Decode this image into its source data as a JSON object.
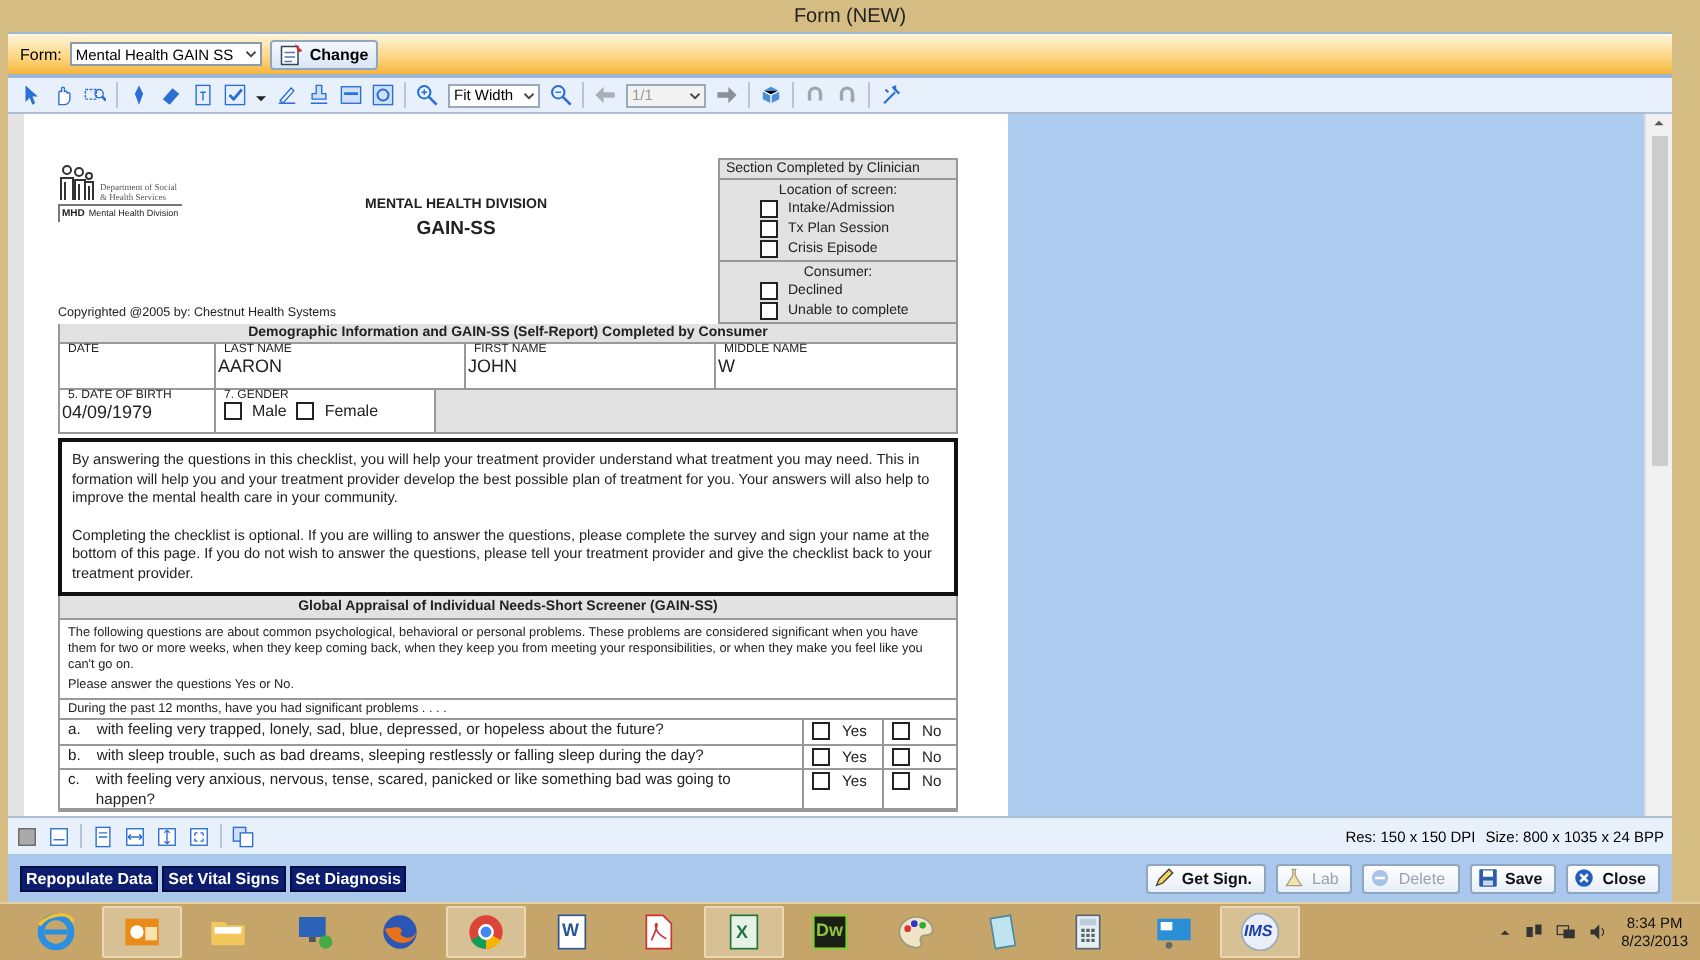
{
  "window": {
    "title": "Form (NEW)"
  },
  "form_selector": {
    "label": "Form:",
    "value": "Mental Health GAIN SS",
    "button": "Change"
  },
  "toolbar": {
    "zoom": "Fit Width",
    "page": "1/1"
  },
  "document": {
    "logo": {
      "agency": "Department of Social & Health Services",
      "unit": "MHD",
      "unit_name": "Mental Health Division"
    },
    "division": "MENTAL HEALTH DIVISION",
    "title": "GAIN-SS",
    "copyright": "Copyrighted @2005 by: Chestnut Health Systems",
    "clinician_box": {
      "title": "Section Completed by Clinician",
      "location_label": "Location of screen:",
      "location_options": [
        {
          "label": "Intake/Admission",
          "checked": false
        },
        {
          "label": "Tx Plan Session",
          "checked": false
        },
        {
          "label": "Crisis Episode",
          "checked": false
        }
      ],
      "consumer_label": "Consumer:",
      "consumer_options": [
        {
          "label": "Declined",
          "checked": false
        },
        {
          "label": "Unable to complete",
          "checked": false
        }
      ]
    },
    "demographics": {
      "title": "Demographic Information and GAIN-SS (Self-Report) Completed by Consumer",
      "name_fields": [
        {
          "label": "DATE"
        },
        {
          "label": "LAST NAME",
          "value": "AARON"
        },
        {
          "label": "FIRST NAME",
          "value": "JOHN"
        },
        {
          "label": "MIDDLE NAME",
          "value": "W"
        }
      ],
      "birth": {
        "label": "5. DATE OF BIRTH",
        "value": "04/09/1979"
      },
      "gender": {
        "label": "7. GENDER",
        "options": [
          {
            "label": "Male",
            "checked": false
          },
          {
            "label": "Female",
            "checked": false
          }
        ]
      }
    },
    "consent_paragraphs": [
      "By answering the questions in this checklist, you will help your treatment provider understand what treatment you may need.  This in formation will help you and your treatment provider develop the best possible plan of treatment for you.  Your answers will also help to improve the mental health care in your community.",
      "Completing the checklist is optional.  If you are willing to answer the questions, please complete the survey and sign your name at the bottom of this page.  If you do not wish to answer the questions, please tell your treatment provider and give the checklist back to your treatment provider."
    ],
    "screener": {
      "title": "Global Appraisal of Individual Needs-Short Screener (GAIN-SS)",
      "intro": "The following questions are about common psychological, behavioral or personal problems.  These problems are considered significant when you have them for two or more weeks, when they keep coming back, when they keep you from meeting your responsibilities, or when they make you feel like you can't go on.",
      "instruction": "Please answer the questions Yes or No.",
      "lead": "During the past 12 months, have you had significant problems . . . .",
      "questions": [
        {
          "letter": "a.",
          "text": "with feeling very trapped, lonely, sad, blue, depressed, or hopeless about the future?",
          "yes_label": "Yes",
          "no_label": "No",
          "yes_checked": false,
          "no_checked": false
        },
        {
          "letter": "b.",
          "text": "with sleep trouble, such as bad dreams, sleeping restlessly or falling sleep during the day?",
          "yes_label": "Yes",
          "no_label": "No",
          "yes_checked": false,
          "no_checked": false
        },
        {
          "letter": "c.",
          "text": "with feeling very anxious, nervous, tense, scared, panicked or like something bad was going to happen?",
          "yes_label": "Yes",
          "no_label": "No",
          "yes_checked": false,
          "no_checked": false
        }
      ]
    }
  },
  "status_bar": {
    "resolution": "Res:  150 x 150 DPI",
    "size": "Size:  800 x 1035 x 24 BPP"
  },
  "action_links": [
    "Repopulate Data",
    "Set Vital Signs",
    "Set Diagnosis"
  ],
  "buttons": [
    {
      "label": "Get Sign.",
      "kind": "pen",
      "disabled": false
    },
    {
      "label": "Lab",
      "kind": "flask",
      "disabled": true
    },
    {
      "label": "Delete",
      "kind": "delete",
      "disabled": true
    },
    {
      "label": "Save",
      "kind": "disk",
      "disabled": false
    },
    {
      "label": "Close",
      "kind": "close",
      "disabled": false
    }
  ],
  "taskbar": {
    "apps": [
      {
        "kind": "browser-e",
        "running": false
      },
      {
        "kind": "mail",
        "running": true
      },
      {
        "kind": "folder",
        "running": false
      },
      {
        "kind": "network",
        "running": false
      },
      {
        "kind": "fox",
        "running": false
      },
      {
        "kind": "chrome",
        "running": true
      },
      {
        "kind": "word",
        "label": "W",
        "running": false
      },
      {
        "kind": "pdf",
        "running": false
      },
      {
        "kind": "excel",
        "label": "X",
        "running": true
      },
      {
        "kind": "dw",
        "label": "Dw",
        "running": false
      },
      {
        "kind": "paint",
        "running": false
      },
      {
        "kind": "notepad",
        "running": false
      },
      {
        "kind": "calculator",
        "running": false
      },
      {
        "kind": "remote",
        "running": false
      },
      {
        "kind": "ims",
        "label": "IMS",
        "running": true
      }
    ],
    "time": "8:34 PM",
    "date": "8/23/2013"
  }
}
